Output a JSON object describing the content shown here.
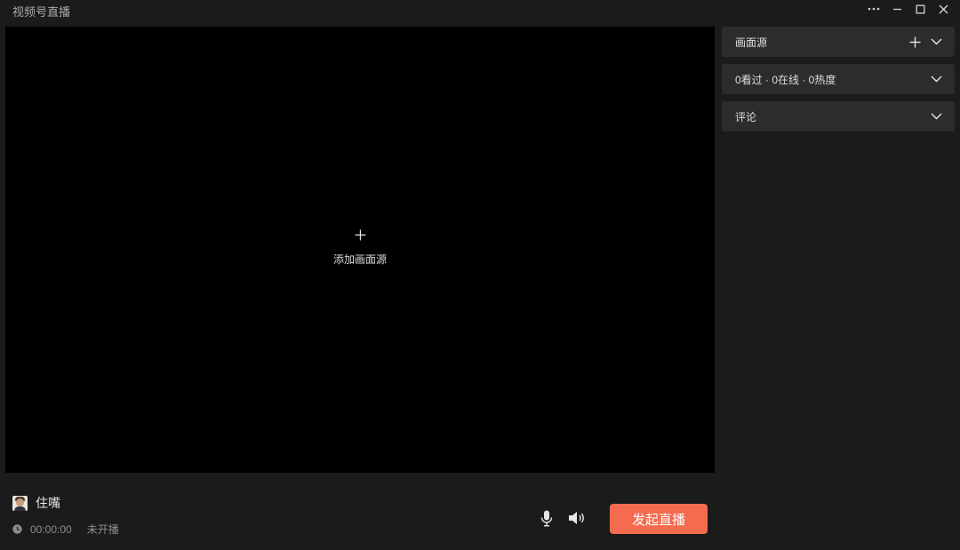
{
  "window": {
    "title": "视频号直播",
    "controls": [
      "more-icon",
      "minimize-icon",
      "maximize-icon",
      "close-icon"
    ]
  },
  "preview": {
    "add_source_label": "添加画面源",
    "add_icon": "plus-icon"
  },
  "sidebar": {
    "panels": [
      {
        "title": "画面源",
        "icons": [
          "plus-icon",
          "chevron-down-icon"
        ]
      },
      {
        "title": "0看过 · 0在线 · 0热度",
        "icons": [
          "chevron-down-icon"
        ]
      },
      {
        "title": "评论",
        "icons": [
          "chevron-down-icon"
        ]
      }
    ]
  },
  "footer": {
    "user_name": "住嘴",
    "avatar": "avatar-image",
    "duration": "00:00:00",
    "live_status": "未开播",
    "mic_icon": "microphone-icon",
    "speaker_icon": "speaker-icon",
    "start_button": "发起直播"
  },
  "colors": {
    "background": "#1b1b1b",
    "preview": "#000000",
    "panel": "#2c2c2c",
    "accent": "#f46b4f"
  }
}
